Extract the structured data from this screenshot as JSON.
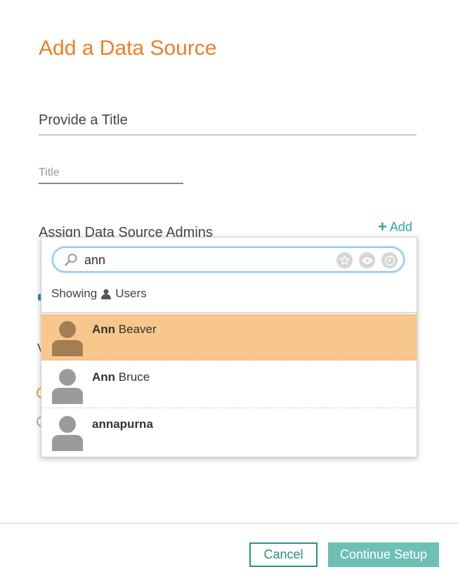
{
  "dialog": {
    "title": "Add a Data Source",
    "section_title": "Provide a Title",
    "title_field": {
      "value": "",
      "placeholder": "Title"
    },
    "admins_heading": "Assign Data Source Admins",
    "add_label": "Add"
  },
  "picker": {
    "search_value": "ann",
    "filter_icons": [
      "star-icon",
      "eye-icon",
      "clock-icon"
    ],
    "showing_prefix": "Showing",
    "showing_type": "Users",
    "results": [
      {
        "match": "Ann",
        "rest": " Beaver",
        "selected": true
      },
      {
        "match": "Ann",
        "rest": " Bruce",
        "selected": false
      },
      {
        "match": "annapurna",
        "rest": "",
        "selected": false
      }
    ]
  },
  "footer": {
    "cancel_label": "Cancel",
    "continue_label": "Continue Setup"
  },
  "colors": {
    "accent_orange": "#f07d26",
    "teal": "#2a8f86",
    "selected_row": "#f8c78b",
    "continue_button": "#6ec0b4"
  }
}
